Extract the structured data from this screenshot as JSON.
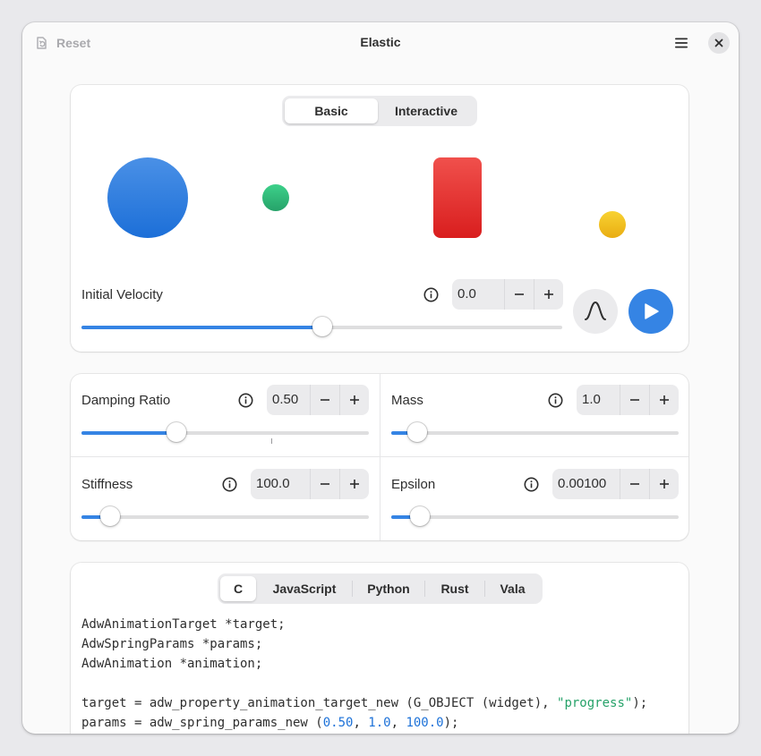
{
  "header": {
    "reset_label": "Reset",
    "title": "Elastic"
  },
  "demo": {
    "tabs": [
      {
        "label": "Basic",
        "active": true
      },
      {
        "label": "Interactive",
        "active": false
      }
    ],
    "shapes": {
      "big_circle_color": "#3584e4",
      "small_circle_color": "#2ec27e",
      "rect_color": "#e01b24",
      "dot_color": "#f6c51f"
    },
    "velocity": {
      "label": "Initial Velocity",
      "value": "0.0",
      "slider_fraction": 0.5
    }
  },
  "params": {
    "damping": {
      "label": "Damping Ratio",
      "value": "0.50",
      "slider_fraction": 0.33
    },
    "mass": {
      "label": "Mass",
      "value": "1.0",
      "slider_fraction": 0.09
    },
    "stiffness": {
      "label": "Stiffness",
      "value": "100.0",
      "slider_fraction": 0.1
    },
    "epsilon": {
      "label": "Epsilon",
      "value": "0.00100",
      "slider_fraction": 0.1
    }
  },
  "code": {
    "languages": [
      {
        "label": "C",
        "active": true
      },
      {
        "label": "JavaScript",
        "active": false
      },
      {
        "label": "Python",
        "active": false
      },
      {
        "label": "Rust",
        "active": false
      },
      {
        "label": "Vala",
        "active": false
      }
    ],
    "lines": [
      "AdwAnimationTarget *target;",
      "AdwSpringParams *params;",
      "AdwAnimation *animation;",
      "",
      "target = adw_property_animation_target_new (G_OBJECT (widget), ",
      "params = adw_spring_params_new ("
    ],
    "string_progress": "\"progress\"",
    "line5_end": ");",
    "num_damping": "0.50",
    "num_mass": "1.0",
    "num_stiffness": "100.0",
    "sep": ", ",
    "line6_end": ");"
  },
  "colors": {
    "accent": "#3584e4"
  }
}
